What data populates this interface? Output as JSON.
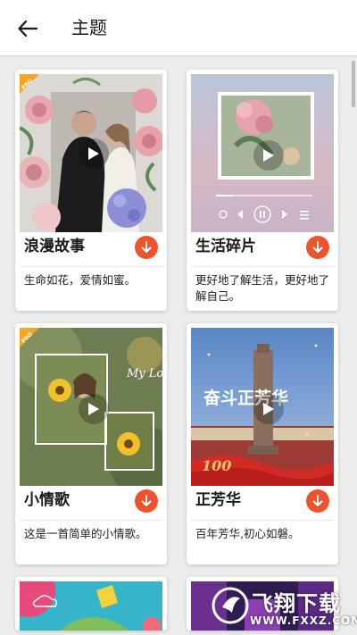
{
  "header": {
    "back_icon": "arrow-left-icon",
    "title": "主题"
  },
  "themes": [
    {
      "name": "浪漫故事",
      "description": "生命如花，爱情如蜜。",
      "pro": true,
      "pro_badge": "PRO",
      "download_icon": "download-arrow-icon"
    },
    {
      "name": "生活碎片",
      "description": "更好地了解生活，更好地了解自己。",
      "pro": false,
      "download_icon": "download-arrow-icon"
    },
    {
      "name": "小情歌",
      "description": "这是一首简单的小情歌。",
      "pro": true,
      "pro_badge": "PRO",
      "preview_overlay_text": "My Love",
      "download_icon": "download-arrow-icon"
    },
    {
      "name": "正芳华",
      "description": "百年芳华,初心如磐。",
      "pro": false,
      "preview_overlay_text": "奋斗正芳华",
      "preview_badge": "100",
      "download_icon": "download-arrow-icon"
    }
  ],
  "watermark": {
    "title": "飞翔下载",
    "url": "WWW.FXXZ.COM"
  },
  "colors": {
    "accent": "#f0532c",
    "pro_badge": "#f5a623",
    "background": "#ececec"
  }
}
